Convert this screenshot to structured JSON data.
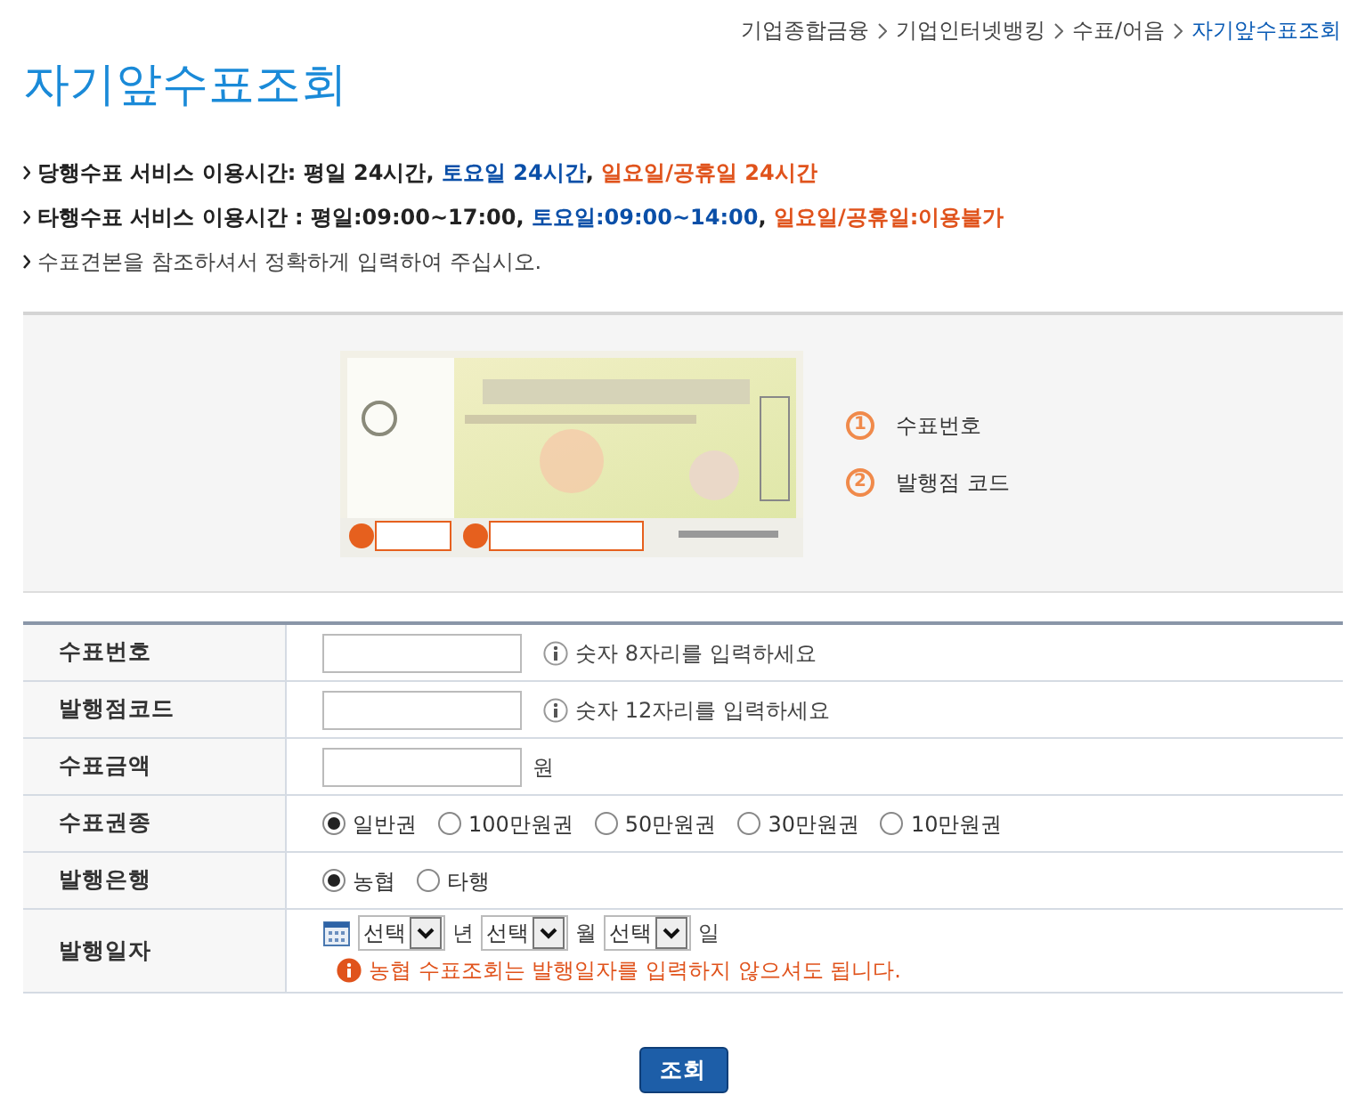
{
  "breadcrumb": [
    {
      "label": "기업종합금융",
      "current": false
    },
    {
      "label": "기업인터넷뱅킹",
      "current": false
    },
    {
      "label": "수표/어음",
      "current": false
    },
    {
      "label": "자기앞수표조회",
      "current": true
    }
  ],
  "title": "자기앞수표조회",
  "notices": [
    {
      "bold": true,
      "segments": [
        {
          "text": "당행수표 서비스 이용시간: 평일 24시간, ",
          "color": "#222222"
        },
        {
          "text": "토요일 24시간",
          "color": "#0a4fa8"
        },
        {
          "text": ", ",
          "color": "#222222"
        },
        {
          "text": "일요일/공휴일 24시간",
          "color": "#e0531c"
        }
      ]
    },
    {
      "bold": true,
      "segments": [
        {
          "text": "타행수표 서비스 이용시간 : 평일:09:00~17:00, ",
          "color": "#222222"
        },
        {
          "text": "토요일:09:00~14:00",
          "color": "#0a4fa8"
        },
        {
          "text": ", ",
          "color": "#222222"
        },
        {
          "text": "일요일/공휴일:이용불가",
          "color": "#e0531c"
        }
      ]
    },
    {
      "bold": false,
      "segments": [
        {
          "text": "수표견본을 참조하셔서 정확하게 입력하여 주십시오.",
          "color": "#444444"
        }
      ]
    }
  ],
  "sample": {
    "legend": [
      {
        "number": "1",
        "label": "수표번호"
      },
      {
        "number": "2",
        "label": "발행점 코드"
      }
    ]
  },
  "form": [
    {
      "kind": "input",
      "label": "수표번호",
      "hint": "숫자 8자리를 입력하세요"
    },
    {
      "kind": "input",
      "label": "발행점코드",
      "hint": "숫자 12자리를 입력하세요"
    },
    {
      "kind": "unit",
      "label": "수표금액",
      "unit": "원"
    },
    {
      "kind": "radio",
      "label": "수표권종",
      "options": [
        {
          "label": "일반권",
          "selected": true
        },
        {
          "label": "100만원권",
          "selected": false
        },
        {
          "label": "50만원권",
          "selected": false
        },
        {
          "label": "30만원권",
          "selected": false
        },
        {
          "label": "10만원권",
          "selected": false
        }
      ]
    },
    {
      "kind": "radio",
      "label": "발행은행",
      "options": [
        {
          "label": "농협",
          "selected": true
        },
        {
          "label": "타행",
          "selected": false
        }
      ]
    },
    {
      "kind": "date",
      "label": "발행일자",
      "selects": [
        {
          "value": "선택",
          "unit": "년"
        },
        {
          "value": "선택",
          "unit": "월"
        },
        {
          "value": "선택",
          "unit": "일"
        }
      ],
      "note": "농협 수표조회는 발행일자를 입력하지 않으셔도 됩니다."
    }
  ],
  "button": "조회"
}
